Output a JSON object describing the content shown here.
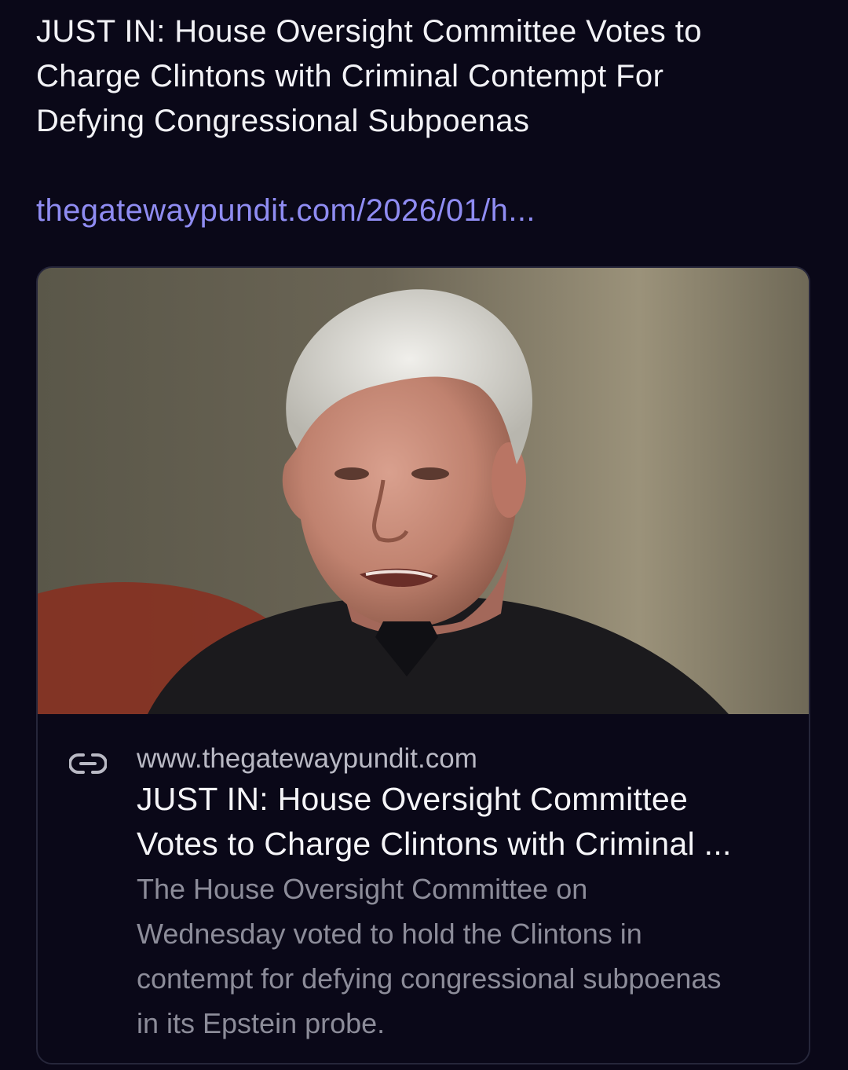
{
  "post": {
    "text": "JUST IN: House Oversight Committee Votes to\nCharge Clintons with Criminal Contempt For\nDefying Congressional Subpoenas",
    "link_text": "thegatewaypundit.com/2026/01/h..."
  },
  "card": {
    "image_icon": "photo-of-man",
    "link_icon": "link-icon",
    "domain": "www.thegatewaypundit.com",
    "title_line1": "JUST IN: House Oversight Committee",
    "title_line2": "Votes to Charge Clintons with Criminal ...",
    "description": "        The House Oversight Committee on\nWednesday voted to hold the Clintons in\ncontempt for defying congressional subpoenas\nin its Epstein probe."
  },
  "colors": {
    "background": "#0a0818",
    "link": "#8f8cf2",
    "text": "#f2f2f6",
    "muted": "#8c8c99",
    "card_border": "#26263a"
  }
}
